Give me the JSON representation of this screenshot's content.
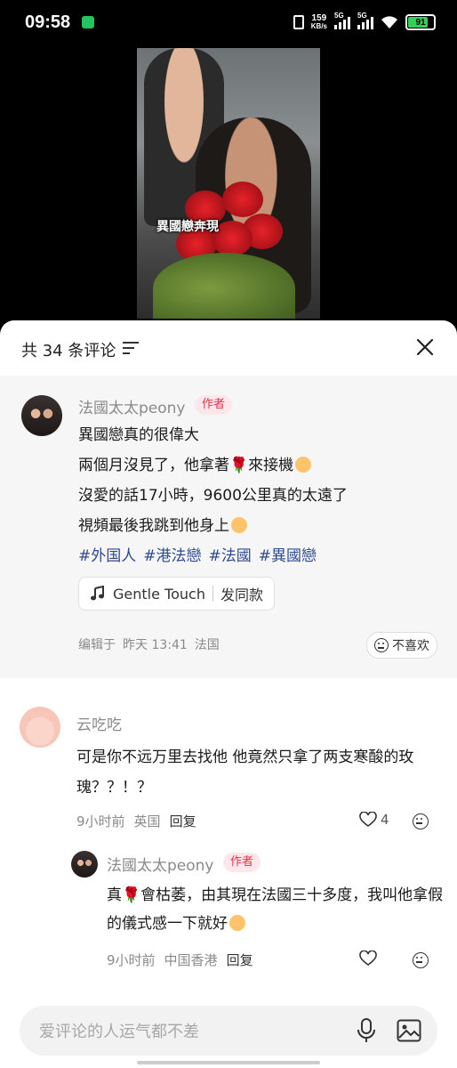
{
  "status_bar": {
    "time": "09:58",
    "network_speed": "159",
    "network_unit": "KB/s",
    "signal1_label": "5G",
    "signal2_label": "5G",
    "battery": "91"
  },
  "video": {
    "caption": "異國戀奔現"
  },
  "comments_panel": {
    "title": "共 34 条评论"
  },
  "pinned": {
    "author": "法國太太peony",
    "badge": "作者",
    "lines": [
      "異國戀真的很偉大",
      "兩個月沒見了，他拿著",
      "來接機",
      "沒愛的話17小時，9600公里真的太遠了",
      "視頻最後我跳到他身上"
    ],
    "hashtags": [
      "#外国人",
      "#港法戀",
      "#法國",
      "#異國戀"
    ],
    "music_title": "Gentle Touch",
    "music_action": "发同款",
    "edited_label": "编辑于",
    "edited_time": "昨天 13:41",
    "location": "法国",
    "dislike_label": "不喜欢"
  },
  "comment1": {
    "author": "云吃吃",
    "text": "可是你不远万里去找他 他竟然只拿了两支寒酸的玫瑰？？！？",
    "time": "9小时前",
    "location": "英国",
    "reply_label": "回复",
    "likes": "4"
  },
  "reply1": {
    "author": "法國太太peony",
    "badge": "作者",
    "text_a": "真",
    "text_b": "會枯萎，由其現在法國三十多度，我叫他拿假的儀式感一下就好",
    "time": "9小时前",
    "location": "中国香港",
    "reply_label": "回复"
  },
  "input": {
    "placeholder": "爱评论的人运气都不差"
  },
  "icons": {
    "sort": "sort-icon",
    "close": "close-icon",
    "music": "music-note-icon",
    "heart": "heart-icon",
    "dislike": "dislike-face-icon",
    "mic": "microphone-icon",
    "image": "image-icon"
  },
  "colors": {
    "author_badge_text": "#e5334a",
    "author_badge_bg": "#fde7ea",
    "hashtag": "#2e4b8f",
    "battery_fill": "#34d058"
  }
}
